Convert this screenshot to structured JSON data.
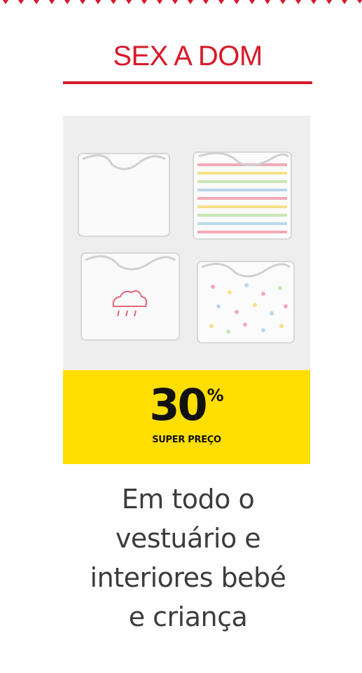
{
  "header": {
    "day_range": "SEX A DOM"
  },
  "promo": {
    "discount_value": "30",
    "discount_unit": "%",
    "tag": "SUPER PREÇO"
  },
  "description": {
    "lines": [
      "Em todo o",
      "vestuário e",
      "interiores bebé",
      "e criança"
    ]
  },
  "colors": {
    "brand_red": "#d7192a",
    "promo_yellow": "#ffde00",
    "image_bg": "#eeeeee"
  },
  "icons": [
    "baby-bodysuit-plain",
    "baby-bodysuit-striped",
    "baby-bodysuit-cloud",
    "baby-bodysuit-dotted"
  ]
}
